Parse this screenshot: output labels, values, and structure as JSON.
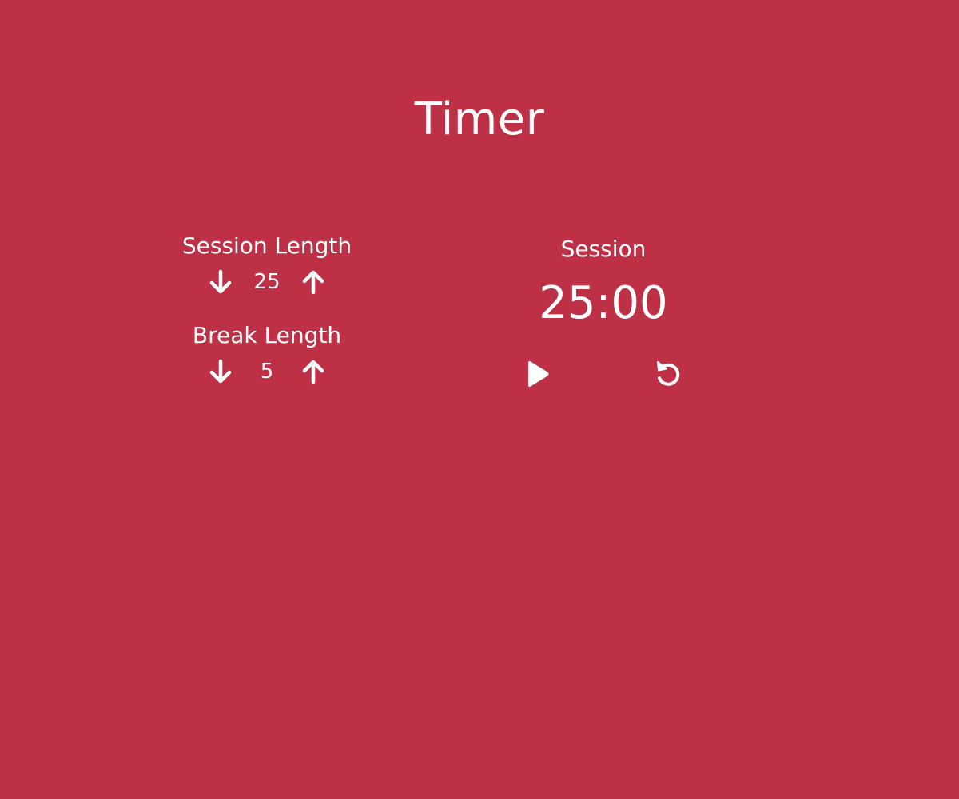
{
  "app": {
    "title": "Timer",
    "background_color": "#bd3045",
    "text_color": "#ffffff"
  },
  "settings": {
    "session": {
      "label": "Session Length",
      "value": "25",
      "decrement_icon": "arrow-down-icon",
      "increment_icon": "arrow-up-icon"
    },
    "break": {
      "label": "Break Length",
      "value": "5",
      "decrement_icon": "arrow-down-icon",
      "increment_icon": "arrow-up-icon"
    }
  },
  "timer": {
    "label": "Session",
    "time": "25:00",
    "start_icon": "play-icon",
    "reset_icon": "reset-icon"
  }
}
